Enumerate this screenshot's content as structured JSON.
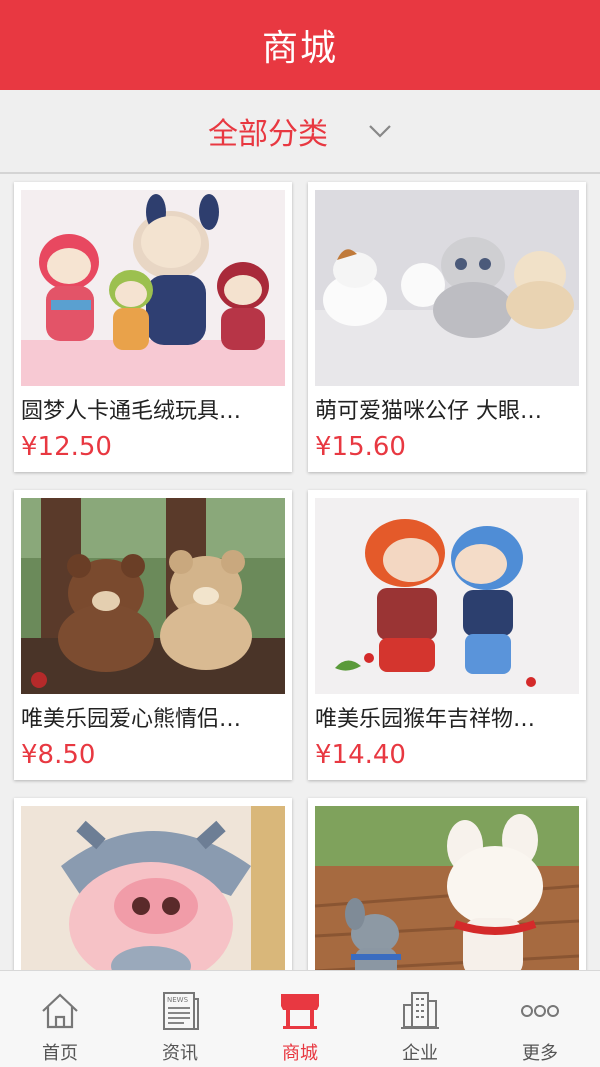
{
  "header": {
    "title": "商城"
  },
  "filter": {
    "label": "全部分类",
    "icon": "chevron-down-icon"
  },
  "products": [
    {
      "name": "圆梦人卡通毛绒玩具…",
      "price": "¥12.50",
      "image": "plush-rabbits-photo"
    },
    {
      "name": "萌可爱猫咪公仔 大眼…",
      "price": "¥15.60",
      "image": "plush-cats-photo"
    },
    {
      "name": "唯美乐园爱心熊情侣…",
      "price": "¥8.50",
      "image": "teddy-bears-photo"
    },
    {
      "name": "唯美乐园猴年吉祥物…",
      "price": "¥14.40",
      "image": "plush-monkeys-photo"
    },
    {
      "name": "",
      "price": "",
      "image": "plush-pig-photo"
    },
    {
      "name": "",
      "price": "",
      "image": "plush-mice-photo"
    }
  ],
  "tabbar": {
    "items": [
      {
        "label": "首页",
        "icon": "home-icon"
      },
      {
        "label": "资讯",
        "icon": "news-icon"
      },
      {
        "label": "商城",
        "icon": "shop-icon",
        "active": true
      },
      {
        "label": "企业",
        "icon": "building-icon"
      },
      {
        "label": "更多",
        "icon": "more-icon"
      }
    ]
  },
  "colors": {
    "accent": "#e83841",
    "background": "#f0f0f0",
    "tabbar": "#f7f7f7"
  }
}
